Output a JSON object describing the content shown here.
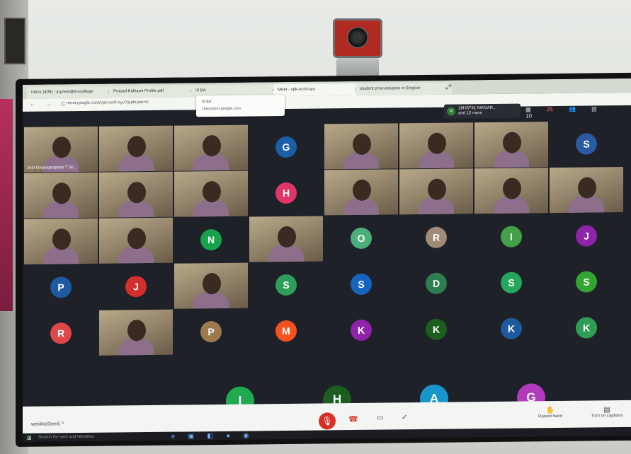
{
  "browser": {
    "tabs": [
      {
        "label": "Inbox (409) - joynext@iescollege",
        "close": "×"
      },
      {
        "label": "Prasad Kulkarni Profile.pdf",
        "close": "×"
      },
      {
        "label": "III BA",
        "close": "×"
      },
      {
        "label": "Meet - vpk-ocnf-nyu",
        "close": "×"
      },
      {
        "label": "student pronunciation in English",
        "close": "×"
      }
    ],
    "new_tab": "+",
    "nav": "← → C",
    "url": "meet.google.com/vpk-ocnf-nyu?authuser=0",
    "tooltip_title": "III BA",
    "tooltip_url": "classroom.google.com"
  },
  "meet": {
    "presenter_initial": "M",
    "presenter_name": "18HST41 MAGAR...",
    "presenter_more": "and 12 more",
    "participant_count": "25",
    "clock": "10",
    "pinned_name": "Joel Gnanaprapash T Sc...",
    "meeting_code": "wekkkd3om5",
    "raise_hand": "Raised hand",
    "captions": "Turn on captions"
  },
  "tiles": [
    {
      "kind": "video",
      "caption": "Joel Gnanaprapash T Sc..."
    },
    {
      "kind": "video"
    },
    {
      "kind": "video"
    },
    {
      "kind": "avatar",
      "letter": "G",
      "color": "#1a5fa8"
    },
    {
      "kind": "video"
    },
    {
      "kind": "video"
    },
    {
      "kind": "video"
    },
    {
      "kind": "avatar",
      "letter": "S",
      "color": "#2c5aa0"
    },
    {
      "kind": "video"
    },
    {
      "kind": "video"
    },
    {
      "kind": "video"
    },
    {
      "kind": "avatar",
      "letter": "H",
      "color": "#e03667"
    },
    {
      "kind": "video"
    },
    {
      "kind": "video"
    },
    {
      "kind": "video"
    },
    {
      "kind": "video"
    },
    {
      "kind": "video"
    },
    {
      "kind": "video"
    },
    {
      "kind": "avatar",
      "letter": "N",
      "color": "#17a34a"
    },
    {
      "kind": "video"
    },
    {
      "kind": "avatar",
      "letter": "O",
      "color": "#4caf7a"
    },
    {
      "kind": "avatar",
      "letter": "R",
      "color": "#a08a78"
    },
    {
      "kind": "avatar",
      "letter": "I",
      "color": "#43a047"
    },
    {
      "kind": "avatar",
      "letter": "J",
      "color": "#8e24aa"
    },
    {
      "kind": "avatar",
      "letter": "P",
      "color": "#1e5aa0"
    },
    {
      "kind": "avatar",
      "letter": "J",
      "color": "#d32f2f"
    },
    {
      "kind": "video"
    },
    {
      "kind": "avatar",
      "letter": "S",
      "color": "#2e9e5a"
    },
    {
      "kind": "avatar",
      "letter": "S",
      "color": "#1565c0"
    },
    {
      "kind": "avatar",
      "letter": "D",
      "color": "#2e7d4f"
    },
    {
      "kind": "avatar",
      "letter": "S",
      "color": "#26a65b"
    },
    {
      "kind": "avatar",
      "letter": "S",
      "color": "#33a532"
    },
    {
      "kind": "avatar",
      "letter": "R",
      "color": "#e04848"
    },
    {
      "kind": "video"
    },
    {
      "kind": "avatar",
      "letter": "P",
      "color": "#9c7a4e"
    },
    {
      "kind": "avatar",
      "letter": "M",
      "color": "#f4511e"
    },
    {
      "kind": "avatar",
      "letter": "K",
      "color": "#8e24aa"
    },
    {
      "kind": "avatar",
      "letter": "K",
      "color": "#1b5e20"
    },
    {
      "kind": "avatar",
      "letter": "K",
      "color": "#1e5a9e"
    },
    {
      "kind": "avatar",
      "letter": "K",
      "color": "#2e9e55"
    }
  ],
  "bottom_row": [
    {
      "letter": "I",
      "color": "#1faa50"
    },
    {
      "letter": "H",
      "color": "#1b5e20"
    },
    {
      "letter": "A",
      "color": "#1797c9"
    },
    {
      "letter": "G",
      "color": "#b13bbd"
    }
  ],
  "taskbar": {
    "start": "⊞",
    "search": "Search the web and Windows"
  }
}
